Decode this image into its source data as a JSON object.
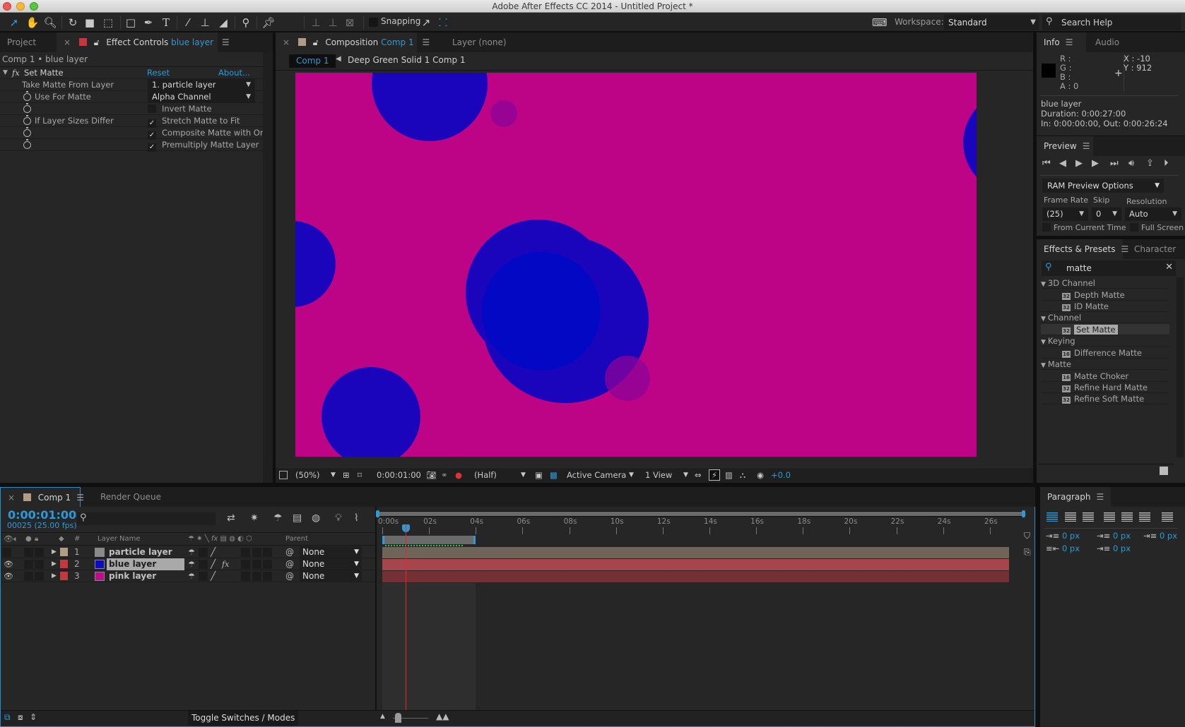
{
  "window": {
    "title": "Adobe After Effects CC 2014 - Untitled Project *"
  },
  "toolbar": {
    "tools": [
      "selection-tool",
      "hand-tool",
      "zoom-tool",
      "rotation-tool",
      "camera-tool",
      "pan-behind-tool",
      "rectangle-tool",
      "pen-tool",
      "type-tool",
      "brush-tool",
      "clone-stamp-tool",
      "eraser-tool",
      "roto-brush-tool",
      "puppet-pin-tool"
    ],
    "snapping_label": "Snapping",
    "workspace_label": "Workspace:",
    "workspace_value": "Standard",
    "search_placeholder": "Search Help"
  },
  "left_panel": {
    "tabs": [
      {
        "label": "Project"
      },
      {
        "label": "Effect Controls",
        "accent": "blue layer"
      }
    ],
    "header": "Comp 1 • blue layer",
    "effect": {
      "name": "Set Matte",
      "reset_label": "Reset",
      "about_label": "About...",
      "properties": [
        {
          "label": "Take Matte From Layer",
          "type": "dropdown",
          "value": "1. particle layer",
          "stopwatch": false
        },
        {
          "label": "Use For Matte",
          "type": "dropdown",
          "value": "Alpha Channel",
          "stopwatch": true
        },
        {
          "label": "",
          "type": "checkbox",
          "value": "Invert Matte",
          "checked": false,
          "stopwatch": true
        },
        {
          "label": "If Layer Sizes Differ",
          "type": "checkbox",
          "value": "Stretch Matte to Fit",
          "checked": true,
          "stopwatch": true
        },
        {
          "label": "",
          "type": "checkbox",
          "value": "Composite Matte with Ori",
          "checked": true,
          "stopwatch": true
        },
        {
          "label": "",
          "type": "checkbox",
          "value": "Premultiply Matte Layer",
          "checked": true,
          "stopwatch": true
        }
      ]
    }
  },
  "comp_panel": {
    "tab_prefix": "Composition",
    "tab_comp": "Comp 1",
    "layer_tab": "Layer (none)",
    "breadcrumb": [
      "Comp 1",
      "Deep Green Solid 1 Comp 1"
    ],
    "colors": {
      "background": "#BE0486",
      "circle": "#1A04BC",
      "overlap": "#0208C4",
      "small": "#8B0398"
    },
    "footer": {
      "magnification": "(50%)",
      "timecode": "0:00:01:00",
      "resolution": "(Half)",
      "camera": "Active Camera",
      "views": "1 View",
      "exposure": "+0.0"
    }
  },
  "info_panel": {
    "tabs": [
      "Info",
      "Audio"
    ],
    "r": "R :",
    "g": "G :",
    "b": "B :",
    "a": "A : 0",
    "x": "X : -10",
    "y": "Y : 912",
    "layer_name": "blue layer",
    "duration": "Duration: 0:00:27:00",
    "in_out": "In: 0:00:00:00, Out: 0:00:26:24"
  },
  "preview_panel": {
    "title": "Preview",
    "ram_options": "RAM Preview Options",
    "frame_rate_label": "Frame Rate",
    "skip_label": "Skip",
    "resolution_label": "Resolution",
    "frame_rate": "(25)",
    "skip": "0",
    "resolution": "Auto",
    "from_current_time": "From Current Time",
    "full_screen": "Full Screen"
  },
  "effects_presets": {
    "tabs": [
      "Effects & Presets",
      "Character"
    ],
    "search_value": "matte",
    "groups": [
      {
        "name": "3D Channel",
        "items": [
          {
            "label": "Depth Matte",
            "bpc": "32"
          },
          {
            "label": "ID Matte",
            "bpc": "32"
          }
        ]
      },
      {
        "name": "Channel",
        "items": [
          {
            "label": "Set Matte",
            "bpc": "32",
            "selected": true
          }
        ]
      },
      {
        "name": "Keying",
        "items": [
          {
            "label": "Difference Matte",
            "bpc": "16"
          }
        ]
      },
      {
        "name": "Matte",
        "items": [
          {
            "label": "Matte Choker",
            "bpc": "16"
          },
          {
            "label": "Refine Hard Matte",
            "bpc": "32"
          },
          {
            "label": "Refine Soft Matte",
            "bpc": "32"
          }
        ]
      }
    ]
  },
  "timeline": {
    "tabs": [
      "Comp 1",
      "Render Queue"
    ],
    "timecode": "0:00:01:00",
    "frame_info": "00025 (25.00 fps)",
    "columns": {
      "number": "#",
      "layer_name": "Layer Name",
      "parent": "Parent"
    },
    "layers": [
      {
        "num": "1",
        "name": "particle layer",
        "label_color": "#B29C83",
        "thumb_color": "#8a8a8a",
        "parent": "None",
        "visible": false,
        "fx": false
      },
      {
        "num": "2",
        "name": "blue layer",
        "label_color": "#C2393D",
        "thumb_color": "#0A0DB8",
        "parent": "None",
        "visible": true,
        "fx": true,
        "selected": true
      },
      {
        "num": "3",
        "name": "pink layer",
        "label_color": "#C2393D",
        "thumb_color": "#C20A8A",
        "parent": "None",
        "visible": true,
        "fx": false
      }
    ],
    "ruler_labels": [
      "0:00s",
      "02s",
      "04s",
      "06s",
      "08s",
      "10s",
      "12s",
      "14s",
      "16s",
      "18s",
      "20s",
      "22s",
      "24s",
      "26s"
    ],
    "current_time_seconds": 1,
    "duration_seconds": 27,
    "work_area_end_seconds": 4,
    "toggle_label": "Toggle Switches / Modes"
  },
  "paragraph_panel": {
    "title": "Paragraph",
    "indent_left": "0 px",
    "indent_before": "0 px",
    "indent_first": "0 px",
    "indent_right": "0 px",
    "space_after": "0 px"
  }
}
